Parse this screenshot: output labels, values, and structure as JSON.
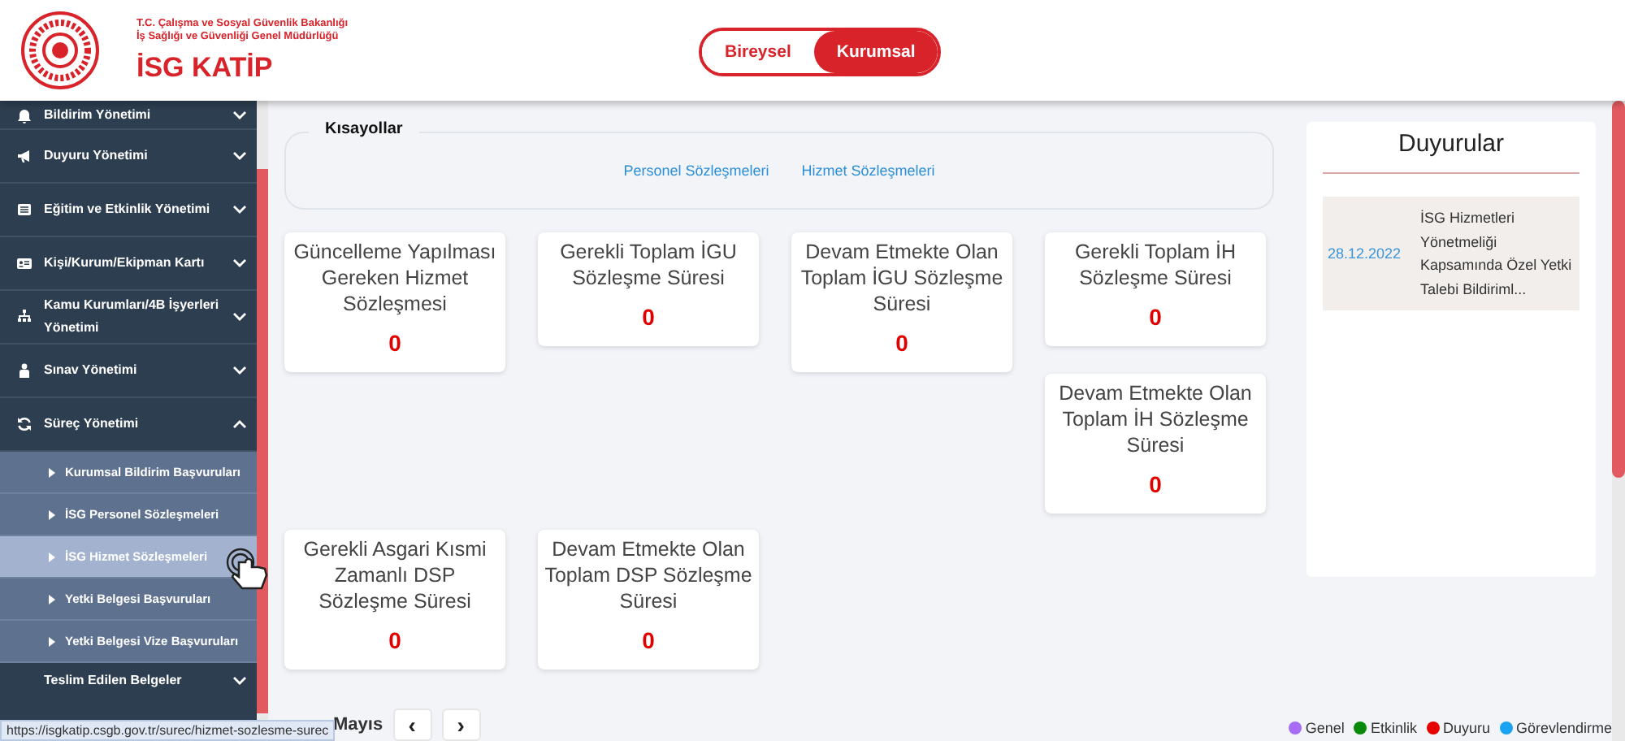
{
  "header": {
    "ministry_lines": [
      "T.C. Çalışma ve Sosyal Güvenlik Bakanlığı",
      "İş Sağlığı ve Güvenliği Genel Müdürlüğü"
    ],
    "brand": "İSG KATİP",
    "toggle": [
      {
        "label": "Bireysel",
        "selected": false
      },
      {
        "label": "Kurumsal",
        "selected": true
      }
    ]
  },
  "sidebar": {
    "items": [
      {
        "label": "Bildirim Yönetimi",
        "expanded": false
      },
      {
        "label": "Duyuru Yönetimi",
        "expanded": false
      },
      {
        "label": "Eğitim ve Etkinlik Yönetimi",
        "expanded": false
      },
      {
        "label": "Kişi/Kurum/Ekipman Kartı",
        "expanded": false
      },
      {
        "label": "Kamu Kurumları/4B İşyerleri Yönetimi",
        "expanded": false
      },
      {
        "label": "Sınav Yönetimi",
        "expanded": false
      },
      {
        "label": "Süreç Yönetimi",
        "expanded": true,
        "children": [
          {
            "label": "Kurumsal Bildirim Başvuruları",
            "selected": false
          },
          {
            "label": "İSG Personel Sözleşmeleri",
            "selected": false
          },
          {
            "label": "İSG Hizmet Sözleşmeleri",
            "selected": true
          },
          {
            "label": "Yetki Belgesi Başvuruları",
            "selected": false
          },
          {
            "label": "Yetki Belgesi Vize Başvuruları",
            "selected": false
          }
        ]
      },
      {
        "label": "Teslim Edilen Belgeler",
        "expanded": false
      }
    ]
  },
  "shortcuts": {
    "title": "Kısayollar",
    "links": [
      "Personel Sözleşmeleri",
      "Hizmet Sözleşmeleri"
    ]
  },
  "card_rows": [
    [
      [
        {
          "title": "Güncelleme Yapılması Gereken Hizmet Sözleşmesi",
          "value": "0"
        }
      ],
      [
        {
          "title": "Gerekli Toplam İGU Sözleşme Süresi",
          "value": "0"
        }
      ],
      [
        {
          "title": "Devam Etmekte Olan Toplam İGU Sözleşme Süresi",
          "value": "0"
        }
      ],
      [
        {
          "title": "Gerekli Toplam İH Sözleşme Süresi",
          "value": "0"
        },
        {
          "title": "Devam Etmekte Olan Toplam İH Sözleşme Süresi",
          "value": "0"
        }
      ]
    ],
    [
      [
        {
          "title": "Gerekli Asgari Kısmi Zamanlı DSP Sözleşme Süresi",
          "value": "0"
        }
      ],
      [
        {
          "title": "Devam Etmekte Olan Toplam DSP Sözleşme Süresi",
          "value": "0"
        }
      ]
    ]
  ],
  "calendar": {
    "month": "Mayıs",
    "prev": "‹",
    "next": "›"
  },
  "legend": [
    {
      "label": "Genel",
      "color": "#a66cf5"
    },
    {
      "label": "Etkinlik",
      "color": "#0a8a0a"
    },
    {
      "label": "Duyuru",
      "color": "#e60000"
    },
    {
      "label": "Görevlendirme",
      "color": "#1aa3f0"
    }
  ],
  "announcements": {
    "title": "Duyurular",
    "items": [
      {
        "date": "28.12.2022",
        "text": "İSG Hizmetleri Yönetmeliği Kapsamında Özel Yetki Talebi Bildiriml..."
      }
    ]
  },
  "status_bar": {
    "url": "https://isgkatip.csgb.gov.tr/surec/hizmet-sozlesme-surec"
  }
}
